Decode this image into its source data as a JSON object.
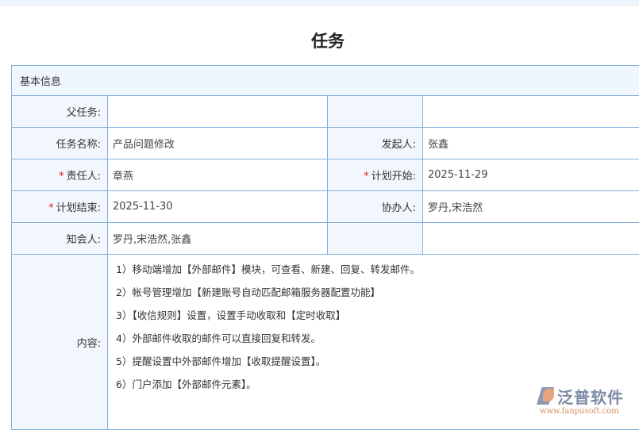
{
  "page": {
    "title": "任务"
  },
  "section": {
    "title": "基本信息"
  },
  "fields": {
    "parent_task": {
      "label": "父任务:",
      "value": ""
    },
    "task_name": {
      "label": "任务名称:",
      "value": "产品问题修改"
    },
    "initiator": {
      "label": "发起人:",
      "value": "张鑫"
    },
    "owner": {
      "label": "责任人:",
      "value": "章燕",
      "required": "*"
    },
    "plan_start": {
      "label": "计划开始:",
      "value": "2025-11-29",
      "required": "*"
    },
    "plan_end": {
      "label": "计划结束:",
      "value": "2025-11-30",
      "required": "*"
    },
    "assistants": {
      "label": "协办人:",
      "value": "罗丹,宋浩然"
    },
    "notify": {
      "label": "知会人:",
      "value": "罗丹,宋浩然,张鑫"
    },
    "content": {
      "label": "内容:",
      "lines": [
        "1）移动端增加【外部邮件】模块，可查看、新建、回复、转发邮件。",
        "2）帐号管理增加【新建账号自动匹配邮箱服务器配置功能】",
        "3）【收信规则】设置，设置手动收取和【定时收取】",
        "4）外部邮件收取的邮件可以直接回复和转发。",
        "5）提醒设置中外部邮件增加【收取提醒设置】。",
        "6）门户添加【外部邮件元素】。"
      ]
    }
  },
  "watermark": {
    "name": "泛普软件",
    "url": "www.fanpusoft.com"
  }
}
